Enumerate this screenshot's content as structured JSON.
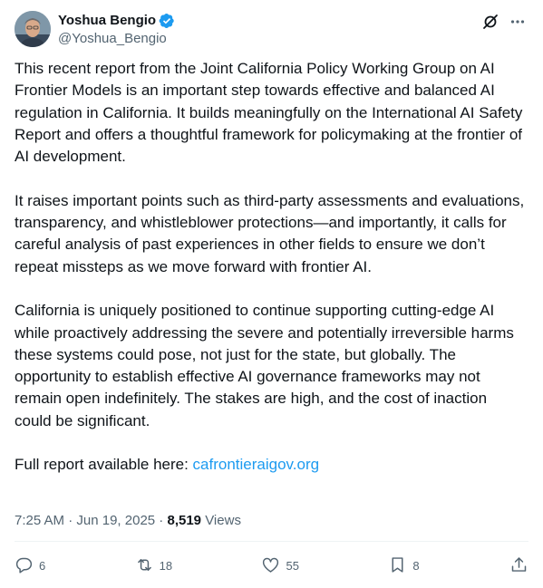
{
  "author": {
    "name": "Yoshua Bengio",
    "handle": "@Yoshua_Bengio"
  },
  "post": {
    "paragraphs": [
      "This recent report from the Joint California Policy Working Group on AI Frontier Models is an important step towards effective and balanced AI regulation in California. It builds meaningfully on the International AI Safety Report and offers a thoughtful framework for policymaking at the frontier of AI development.",
      "It raises important points such as third-party assessments and evaluations, transparency, and whistleblower protections—and importantly, it calls for careful analysis of past experiences in other fields to ensure we don’t repeat missteps as we move forward with frontier AI.",
      "California is uniquely positioned to continue supporting cutting-edge AI while proactively addressing the severe and potentially irreversible harms these systems could pose, not just for the state, but globally. The opportunity to establish effective AI governance frameworks may not remain open indefinitely. The stakes are high, and the cost of inaction could be significant."
    ],
    "report_prefix": "Full report available here: ",
    "report_link": "cafrontieraigov.org"
  },
  "meta": {
    "time": "7:25 AM",
    "sep1": " · ",
    "date": "Jun 19, 2025",
    "sep2": " · ",
    "views_count": "8,519",
    "views_label": " Views"
  },
  "actions": {
    "replies": "6",
    "reposts": "18",
    "likes": "55",
    "bookmarks": "8"
  },
  "icons": {
    "verified": "verified-badge-icon",
    "grok": "grok-icon",
    "more": "more-icon",
    "reply": "reply-icon",
    "repost": "repost-icon",
    "like": "heart-icon",
    "bookmark": "bookmark-icon",
    "share": "share-icon"
  },
  "colors": {
    "text": "#0f1419",
    "secondary": "#536471",
    "link": "#1d9bf0",
    "verified": "#1d9bf0"
  }
}
